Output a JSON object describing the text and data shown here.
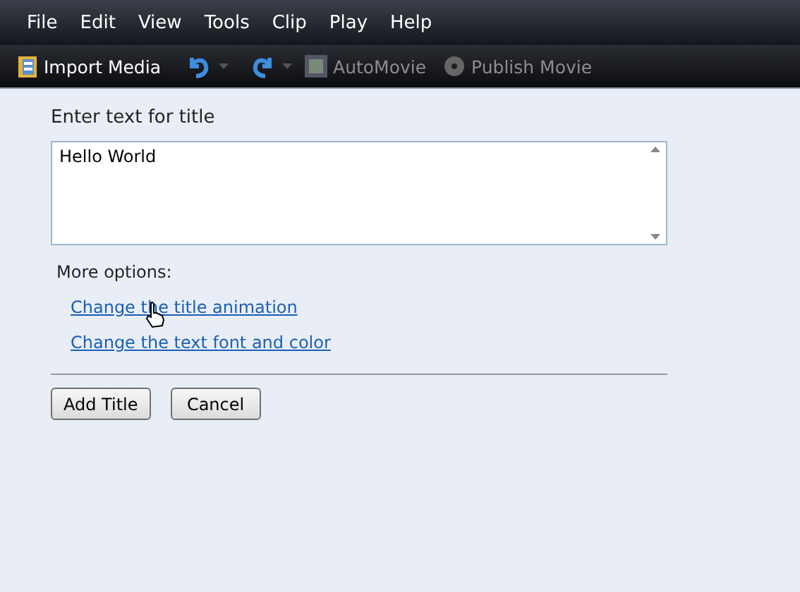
{
  "menu": [
    {
      "label": "File"
    },
    {
      "label": "Edit"
    },
    {
      "label": "View"
    },
    {
      "label": "Tools"
    },
    {
      "label": "Clip"
    },
    {
      "label": "Play"
    },
    {
      "label": "Help"
    }
  ],
  "toolbar": [
    {
      "kind": "import",
      "label": "Import Media",
      "disabled": false
    },
    {
      "kind": "undo",
      "disabled": false
    },
    {
      "kind": "redo",
      "disabled": false
    },
    {
      "kind": "automovie",
      "label": "AutoMovie",
      "disabled": true
    },
    {
      "kind": "publish",
      "label": "Publish Movie",
      "disabled": true
    }
  ],
  "title_field": {
    "label": "Enter text for title",
    "value": "Hello World"
  },
  "more_options": {
    "heading": "More options:",
    "links": [
      "Change the title animation",
      "Change the text font and color"
    ]
  },
  "buttons": [
    "Add Title",
    "Cancel"
  ]
}
